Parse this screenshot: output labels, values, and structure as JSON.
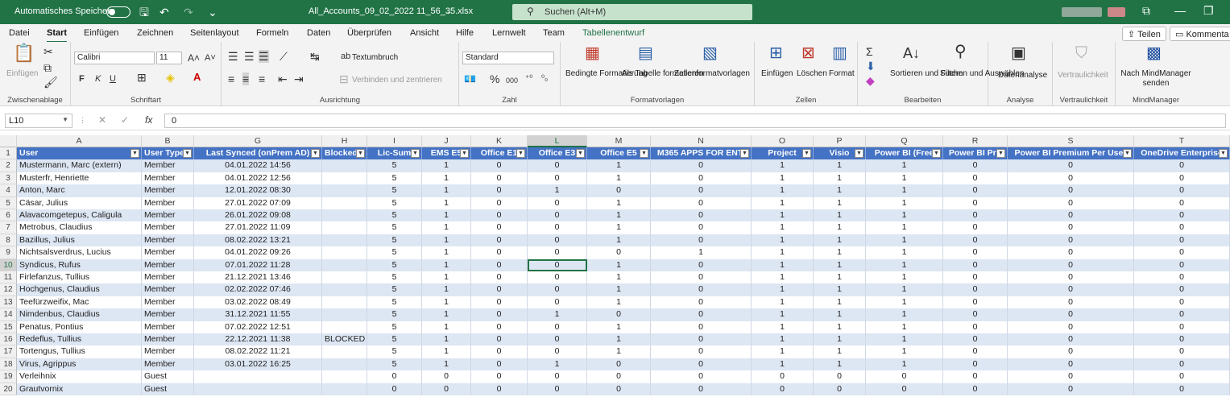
{
  "titlebar": {
    "autosave_label": "Automatisches Speichern",
    "filename": "All_Accounts_09_02_2022 11_56_35.xlsx",
    "search_placeholder": "Suchen (Alt+M)",
    "quick_save": "🖫",
    "quick_undo": "↶",
    "quick_redo": "↷",
    "quick_more": "⌄",
    "win_restore": "⧉",
    "win_min": "—",
    "win_max": "❐"
  },
  "menu": {
    "tabs": [
      "Datei",
      "Start",
      "Einfügen",
      "Zeichnen",
      "Seitenlayout",
      "Formeln",
      "Daten",
      "Überprüfen",
      "Ansicht",
      "Hilfe",
      "Lernwelt",
      "Team",
      "Tabellenentwurf"
    ],
    "active": "Start",
    "share": "Teilen",
    "comments": "Kommenta"
  },
  "ribbon": {
    "clipboard": {
      "paste": "Einfügen",
      "group": "Zwischenablage"
    },
    "font": {
      "name": "Calibri",
      "size": "11",
      "bold": "F",
      "italic": "K",
      "underline": "U",
      "group": "Schriftart"
    },
    "alignment": {
      "wrap": "Textumbruch",
      "merge": "Verbinden und zentrieren",
      "group": "Ausrichtung"
    },
    "number": {
      "format": "Standard",
      "percent": "%",
      "thousands": "000",
      "group": "Zahl"
    },
    "styles": {
      "conditional": "Bedingte Formatierung",
      "as_table": "Als Tabelle formatieren",
      "cell_styles": "Zellenformatvorlagen",
      "group": "Formatvorlagen"
    },
    "cells": {
      "insert": "Einfügen",
      "delete": "Löschen",
      "format": "Format",
      "group": "Zellen"
    },
    "editing": {
      "sort": "Sortieren und Filtern",
      "find": "Suchen und Auswählen",
      "group": "Bearbeiten"
    },
    "analysis": {
      "label": "Datenanalyse",
      "group": "Analyse"
    },
    "sensitivity": {
      "label": "Vertraulichkeit",
      "group": "Vertraulichkeit"
    },
    "mindmanager": {
      "label": "Nach MindManager senden",
      "group": "MindManager"
    }
  },
  "formula_bar": {
    "name_box": "L10",
    "fx": "fx",
    "value": "0"
  },
  "columns": [
    "A",
    "B",
    "G",
    "H",
    "I",
    "J",
    "K",
    "L",
    "M",
    "N",
    "O",
    "P",
    "Q",
    "R",
    "S",
    "T"
  ],
  "selected_column": "L",
  "headers": [
    "User",
    "User Type",
    "Last Synced (onPrem AD)",
    "Blocked",
    "Lic-Sum",
    "EMS E5",
    "Office E1",
    "Office  E3",
    "Office  E5",
    "M365 APPS FOR ENT.",
    "Project",
    "Visio",
    "Power BI (Free",
    "Power BI Pro",
    "Power BI Premium Per User",
    "OneDrive Enterprise"
  ],
  "rows": [
    [
      "Mustermann, Marc (extern)",
      "Member",
      "04.01.2022 14:56",
      "",
      "5",
      "1",
      "0",
      "0",
      "1",
      "0",
      "1",
      "1",
      "1",
      "0",
      "0",
      "0"
    ],
    [
      "Musterfr, Henriette",
      "Member",
      "04.01.2022 12:56",
      "",
      "5",
      "1",
      "0",
      "0",
      "1",
      "0",
      "1",
      "1",
      "1",
      "0",
      "0",
      "0"
    ],
    [
      "Anton, Marc",
      "Member",
      "12.01.2022 08:30",
      "",
      "5",
      "1",
      "0",
      "1",
      "0",
      "0",
      "1",
      "1",
      "1",
      "0",
      "0",
      "0"
    ],
    [
      "Cäsar, Julius",
      "Member",
      "27.01.2022 07:09",
      "",
      "5",
      "1",
      "0",
      "0",
      "1",
      "0",
      "1",
      "1",
      "1",
      "0",
      "0",
      "0"
    ],
    [
      "Alavacomgetepus, Caligula",
      "Member",
      "26.01.2022 09:08",
      "",
      "5",
      "1",
      "0",
      "0",
      "1",
      "0",
      "1",
      "1",
      "1",
      "0",
      "0",
      "0"
    ],
    [
      "Metrobus, Claudius",
      "Member",
      "27.01.2022 11:09",
      "",
      "5",
      "1",
      "0",
      "0",
      "1",
      "0",
      "1",
      "1",
      "1",
      "0",
      "0",
      "0"
    ],
    [
      "Bazillus, Julius",
      "Member",
      "08.02.2022 13:21",
      "",
      "5",
      "1",
      "0",
      "0",
      "1",
      "0",
      "1",
      "1",
      "1",
      "0",
      "0",
      "0"
    ],
    [
      "Nichtsalsverdrus, Lucius",
      "Member",
      "04.01.2022 09:26",
      "",
      "5",
      "1",
      "0",
      "0",
      "0",
      "1",
      "1",
      "1",
      "1",
      "0",
      "0",
      "0"
    ],
    [
      "Syndicus, Rufus",
      "Member",
      "07.01.2022 11:28",
      "",
      "5",
      "1",
      "0",
      "0",
      "1",
      "0",
      "1",
      "1",
      "1",
      "0",
      "0",
      "0"
    ],
    [
      "Firlefanzus, Tullius",
      "Member",
      "21.12.2021 13:46",
      "",
      "5",
      "1",
      "0",
      "0",
      "1",
      "0",
      "1",
      "1",
      "1",
      "0",
      "0",
      "0"
    ],
    [
      "Hochgenus, Claudius",
      "Member",
      "02.02.2022 07:46",
      "",
      "5",
      "1",
      "0",
      "0",
      "1",
      "0",
      "1",
      "1",
      "1",
      "0",
      "0",
      "0"
    ],
    [
      "Teefürzweifix, Mac",
      "Member",
      "03.02.2022 08:49",
      "",
      "5",
      "1",
      "0",
      "0",
      "1",
      "0",
      "1",
      "1",
      "1",
      "0",
      "0",
      "0"
    ],
    [
      "Nimdenbus, Claudius",
      "Member",
      "31.12.2021 11:55",
      "",
      "5",
      "1",
      "0",
      "1",
      "0",
      "0",
      "1",
      "1",
      "1",
      "0",
      "0",
      "0"
    ],
    [
      "Penatus, Pontius",
      "Member",
      "07.02.2022 12:51",
      "",
      "5",
      "1",
      "0",
      "0",
      "1",
      "0",
      "1",
      "1",
      "1",
      "0",
      "0",
      "0"
    ],
    [
      "Redeflus, Tullius",
      "Member",
      "22.12.2021 11:38",
      "BLOCKED",
      "5",
      "1",
      "0",
      "0",
      "1",
      "0",
      "1",
      "1",
      "1",
      "0",
      "0",
      "0"
    ],
    [
      "Tortengus, Tullius",
      "Member",
      "08.02.2022 11:21",
      "",
      "5",
      "1",
      "0",
      "0",
      "1",
      "0",
      "1",
      "1",
      "1",
      "0",
      "0",
      "0"
    ],
    [
      "Virus, Agrippus",
      "Member",
      "03.01.2022 16:25",
      "",
      "5",
      "1",
      "0",
      "1",
      "0",
      "0",
      "1",
      "1",
      "1",
      "0",
      "0",
      "0"
    ],
    [
      "Verleihnix",
      "Guest",
      "",
      "",
      "0",
      "0",
      "0",
      "0",
      "0",
      "0",
      "0",
      "0",
      "0",
      "0",
      "0",
      "0"
    ],
    [
      "Grautvornix",
      "Guest",
      "",
      "",
      "0",
      "0",
      "0",
      "0",
      "0",
      "0",
      "0",
      "0",
      "0",
      "0",
      "0",
      "0"
    ]
  ],
  "selected_cell": {
    "row": 10,
    "col": "L"
  }
}
